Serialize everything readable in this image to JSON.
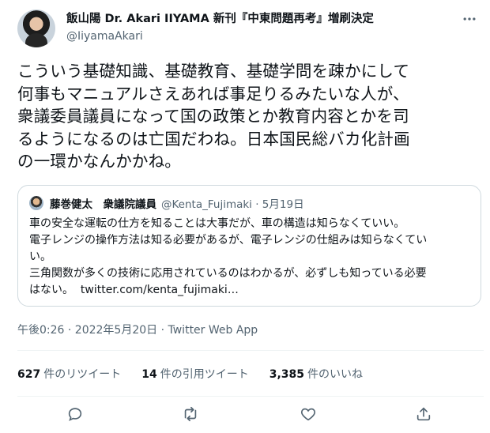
{
  "tweet": {
    "author": {
      "display_name": "飯山陽 Dr. Akari IIYAMA 新刊『中東問題再考』増刷決定",
      "handle": "@IiyamaAkari"
    },
    "text_lines": [
      "こういう基礎知識、基礎教育、基礎学問を疎かにして",
      "何事もマニュアルさえあれば事足りるみたいな人が、",
      "衆議委員議員になって国の政策とか教育内容とかを司",
      "るようになるのは亡国だわね。日本国民総バカ化計画",
      "の一環かなんかかね。"
    ],
    "quote": {
      "author_name": "藤巻健太　衆議院議員",
      "handle_date": "@Kenta_Fujimaki · 5月19日",
      "lines": [
        "車の安全な運転の仕方を知ることは大事だが、車の構造は知らなくていい。",
        "電子レンジの操作方法は知る必要があるが、電子レンジの仕組みは知らなくてい",
        "い。",
        "三角関数が多くの技術に応用されているのはわかるが、必ずしも知っている必要",
        "はない。"
      ],
      "link": "twitter.com/kenta_fujimaki…"
    },
    "meta": {
      "time_date": "午後0:26 · 2022年5月20日",
      "separator": " · ",
      "source": "Twitter Web App"
    },
    "stats": {
      "retweets_count": "627",
      "retweets_label": "件のリツイート",
      "quotes_count": "14",
      "quotes_label": "件の引用ツイート",
      "likes_count": "3,385",
      "likes_label": "件のいいね"
    },
    "actions": [
      "reply-icon",
      "retweet-icon",
      "like-icon",
      "share-icon"
    ],
    "colors": {
      "text": "#0f1419",
      "secondary": "#536471",
      "border": "#cfd9de",
      "divider": "#eff3f4"
    }
  }
}
